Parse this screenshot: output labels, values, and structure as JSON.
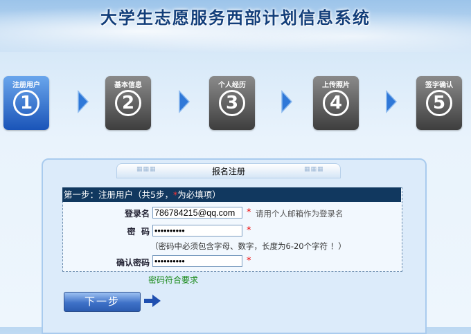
{
  "header": {
    "title": "大学生志愿服务西部计划信息系统"
  },
  "steps": [
    {
      "label": "注册用户",
      "number": "1",
      "active": true
    },
    {
      "label": "基本信息",
      "number": "2",
      "active": false
    },
    {
      "label": "个人经历",
      "number": "3",
      "active": false
    },
    {
      "label": "上传照片",
      "number": "4",
      "active": false
    },
    {
      "label": "签字确认",
      "number": "5",
      "active": false
    }
  ],
  "panel": {
    "title": "报名注册",
    "step_text_prefix": "第一步：注册用户（共5步，",
    "step_text_star": "*",
    "step_text_suffix": "为必填项）"
  },
  "form": {
    "username_label": "登录名",
    "username_value": "786784215@qq.com",
    "username_hint": "请用个人邮箱作为登录名",
    "password_label": "密  码",
    "password_value": "••••••••••",
    "password_hint": "（密码中必须包含字母、数字，长度为6-20个字符 ！）",
    "confirm_label": "确认密码",
    "confirm_value": "••••••••••",
    "required_mark": "*",
    "password_ok": "密码符合要求"
  },
  "buttons": {
    "next_label": "下一步"
  },
  "colors": {
    "step_active": "#1a54b8",
    "step_inactive": "#3e3e3e",
    "bar": "#11385f",
    "ok_text": "#1a8a1a"
  }
}
